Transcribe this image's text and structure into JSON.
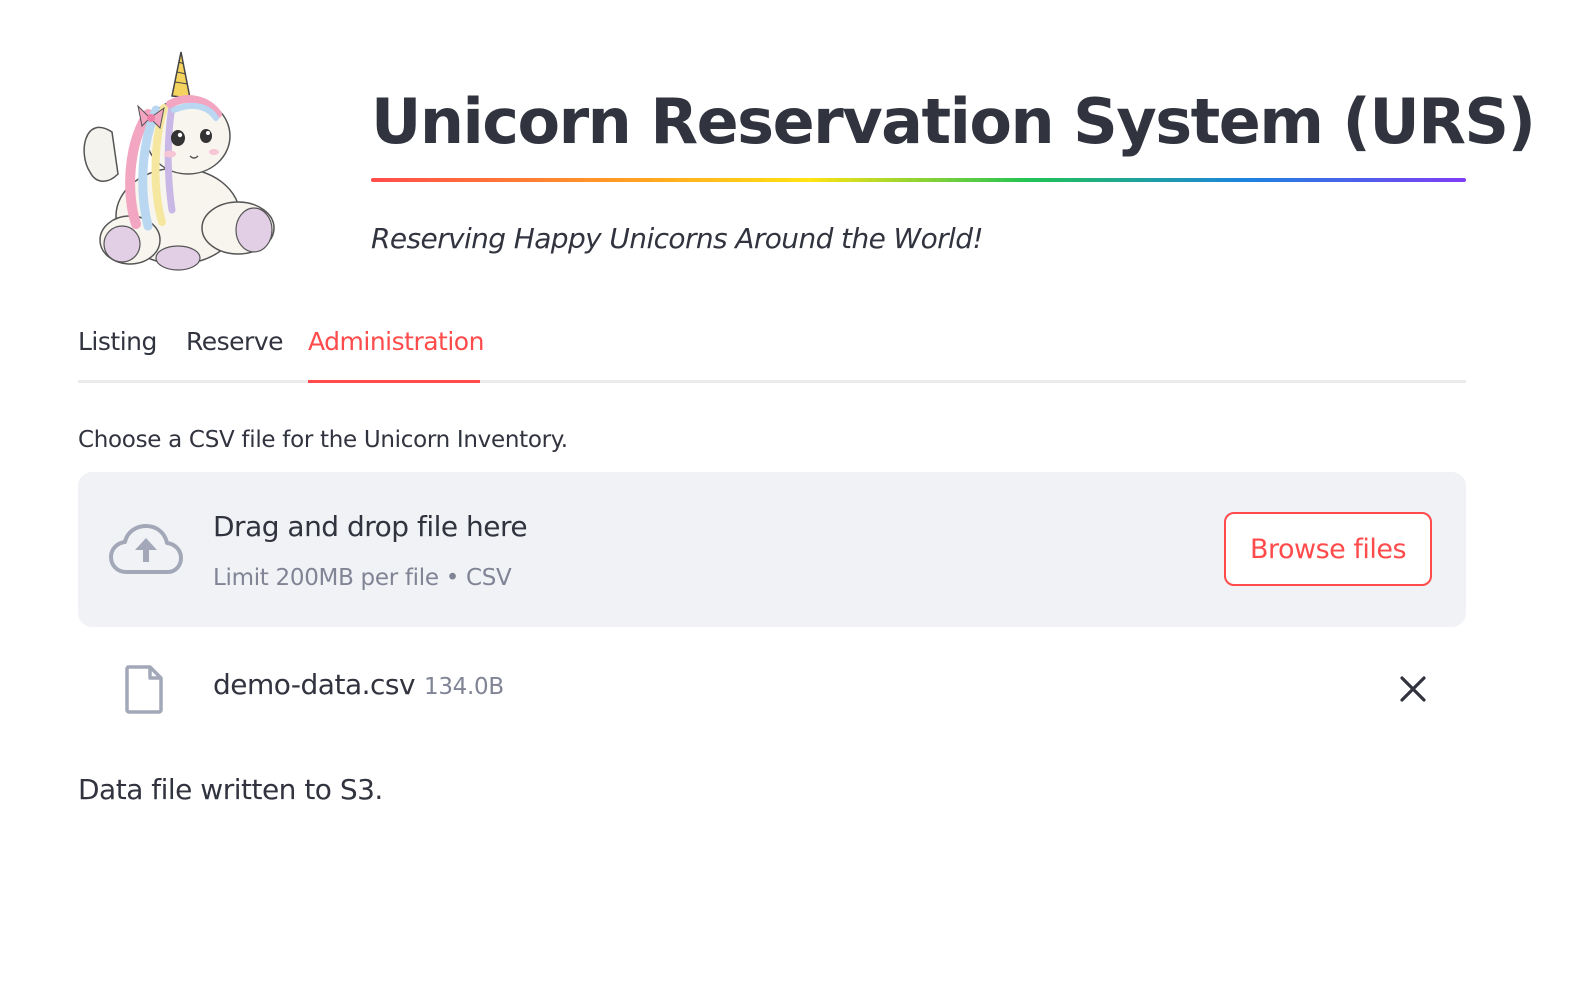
{
  "header": {
    "logo_icon": "unicorn-plush-logo",
    "title": "Unicorn Reservation System (URS)",
    "subtitle": "Reserving Happy Unicorns Around the World!",
    "divider_colors": [
      "#ff4b4b",
      "#ffa421",
      "#ffe312",
      "#21c354",
      "#1c83e1",
      "#803df5"
    ]
  },
  "tabs": [
    {
      "label": "Listing",
      "active": false
    },
    {
      "label": "Reserve",
      "active": false
    },
    {
      "label": "Administration",
      "active": true
    }
  ],
  "uploader": {
    "label": "Choose a CSV file for the Unicorn Inventory.",
    "icon": "cloud-upload-icon",
    "instructions": "Drag and drop file here",
    "limit": "Limit 200MB per file • CSV",
    "browse_label": "Browse files"
  },
  "uploaded_file": {
    "icon": "file-icon",
    "name": "demo-data.csv",
    "size": "134.0B",
    "remove_icon": "close-icon"
  },
  "status": {
    "message": "Data file written to S3."
  },
  "colors": {
    "accent": "#ff4b4b",
    "text": "#31333f",
    "muted": "#808495",
    "dropzone_bg": "#f0f2f6"
  }
}
